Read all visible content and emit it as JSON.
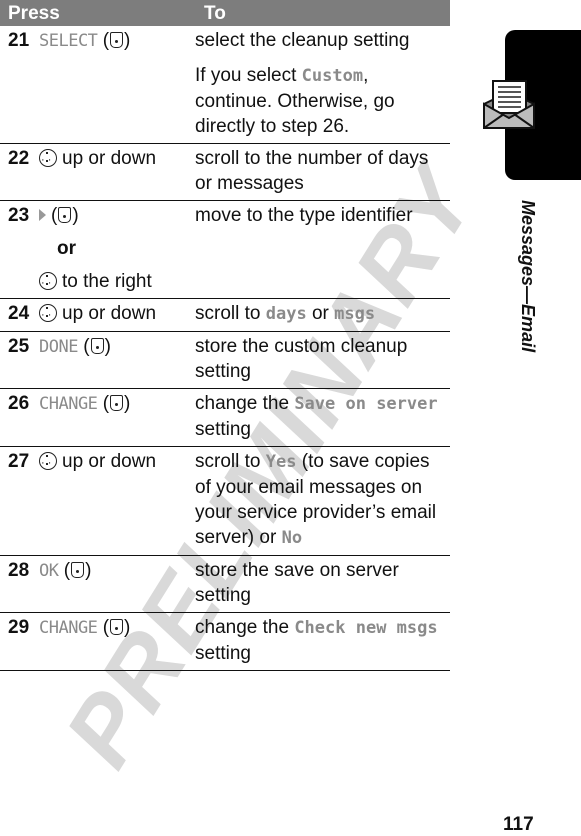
{
  "watermark": "PRELIMINARY",
  "header": {
    "press": "Press",
    "to": "To"
  },
  "rows": [
    {
      "num": "21",
      "key": "SELECT",
      "to_a": "select the cleanup setting",
      "to_b_pre": "If you select ",
      "to_b_disp": "Custom",
      "to_b_post": ", continue. Otherwise, go directly to step 26."
    },
    {
      "num": "22",
      "press_text": "up or down",
      "to": "scroll to the number of days or messages"
    },
    {
      "num": "23",
      "or_label": "or",
      "press_text2": "to the right",
      "to": "move to the type identifier"
    },
    {
      "num": "24",
      "press_text": "up or down",
      "to_pre": "scroll to ",
      "disp1": "days",
      "to_mid": " or ",
      "disp2": "msgs"
    },
    {
      "num": "25",
      "key": "DONE",
      "to": "store the custom cleanup setting"
    },
    {
      "num": "26",
      "key": "CHANGE",
      "to_pre": "change the ",
      "disp": "Save on server",
      "to_post": " setting"
    },
    {
      "num": "27",
      "press_text": "up or down",
      "to_pre": "scroll to ",
      "disp1": "Yes",
      "to_mid": " (to save copies of your email messages on your service provider’s email server)  or ",
      "disp2": "No"
    },
    {
      "num": "28",
      "key": "OK",
      "to": "store the save on server setting"
    },
    {
      "num": "29",
      "key": "CHANGE",
      "to_pre": "change the ",
      "disp": "Check new msgs",
      "to_post": " setting"
    }
  ],
  "section_title": "Messages—Email",
  "page_number": "117",
  "icons": {
    "softkey": "center-select-key-icon",
    "nav": "navigation-key-icon",
    "arrow": "right-arrow-icon",
    "section": "email-envelope-icon"
  }
}
